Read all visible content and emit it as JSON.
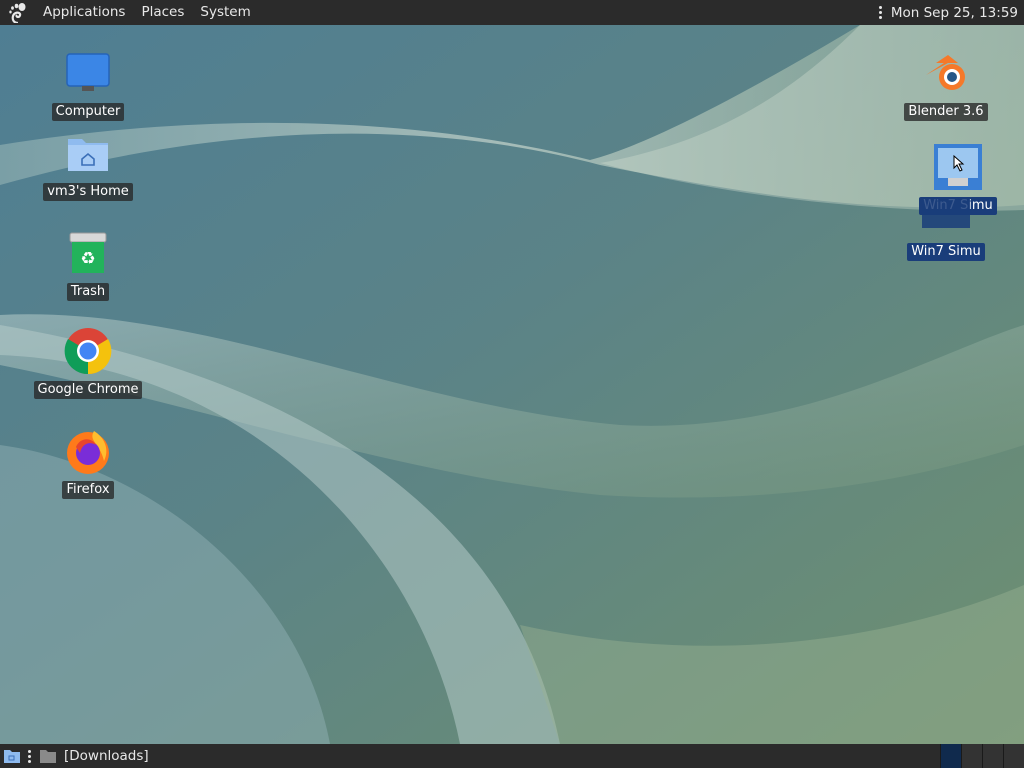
{
  "top_panel": {
    "menus": [
      "Applications",
      "Places",
      "System"
    ],
    "clock": "Mon Sep 25, 13:59"
  },
  "desktop": {
    "left_icons": [
      {
        "label": "Computer",
        "icon": "computer-icon"
      },
      {
        "label": "vm3's Home",
        "icon": "home-folder-icon"
      },
      {
        "label": "Trash",
        "icon": "trash-icon"
      },
      {
        "label": "Google Chrome",
        "icon": "chrome-icon"
      },
      {
        "label": "Firefox",
        "icon": "firefox-icon"
      }
    ],
    "right_icons": [
      {
        "label": "Blender 3.6",
        "icon": "blender-icon"
      },
      {
        "label": "Win7 Simu",
        "icon": "win7-simu-icon"
      },
      {
        "label": "Win7 Simu",
        "icon": "win7-simu-icon"
      }
    ]
  },
  "bottom_panel": {
    "task_label": "[Downloads]",
    "workspaces": 4,
    "active_workspace": 1
  },
  "colors": {
    "panel": "#2b2b2b",
    "selection": "#1a3d7a"
  }
}
